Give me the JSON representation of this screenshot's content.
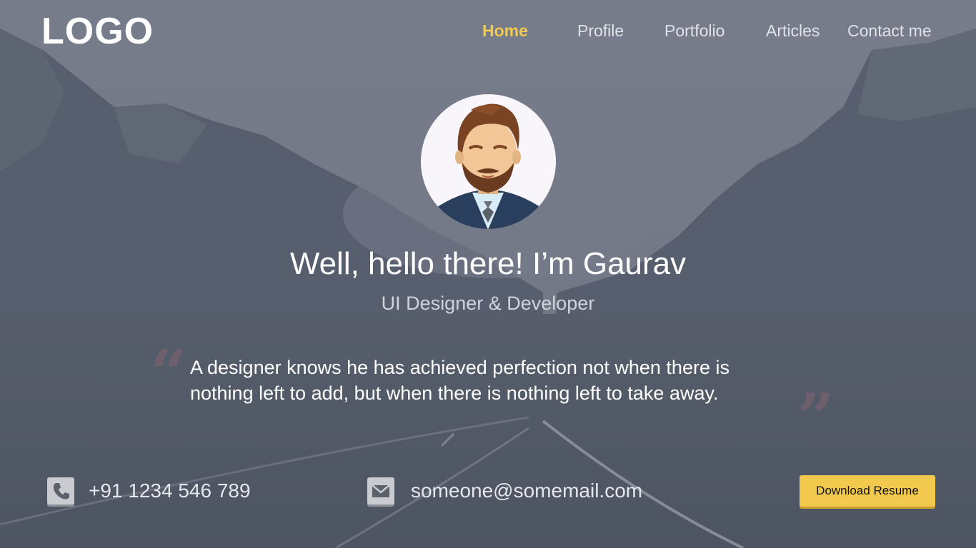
{
  "header": {
    "logo": "LOGO"
  },
  "nav": {
    "items": [
      {
        "label": "Home",
        "active": true
      },
      {
        "label": "Profile",
        "active": false
      },
      {
        "label": "Portfolio",
        "active": false
      },
      {
        "label": "Articles",
        "active": false
      },
      {
        "label": "Contact me",
        "active": false
      }
    ]
  },
  "hero": {
    "title": "Well, hello there! I’m Gaurav",
    "subtitle": "UI Designer & Developer",
    "quote_line1": "A designer knows he has achieved perfection not when there is",
    "quote_line2": "nothing left to add, but when there is nothing left to take away."
  },
  "contact": {
    "phone_icon": "phone-icon",
    "phone": "+91 1234 546 789",
    "email_icon": "mail-icon",
    "email": "someone@somemail.com",
    "download_label": "Download Resume"
  },
  "colors": {
    "accent": "#f2c94c",
    "background": "#565d6b",
    "quote_mark": "#6e5f6c"
  }
}
